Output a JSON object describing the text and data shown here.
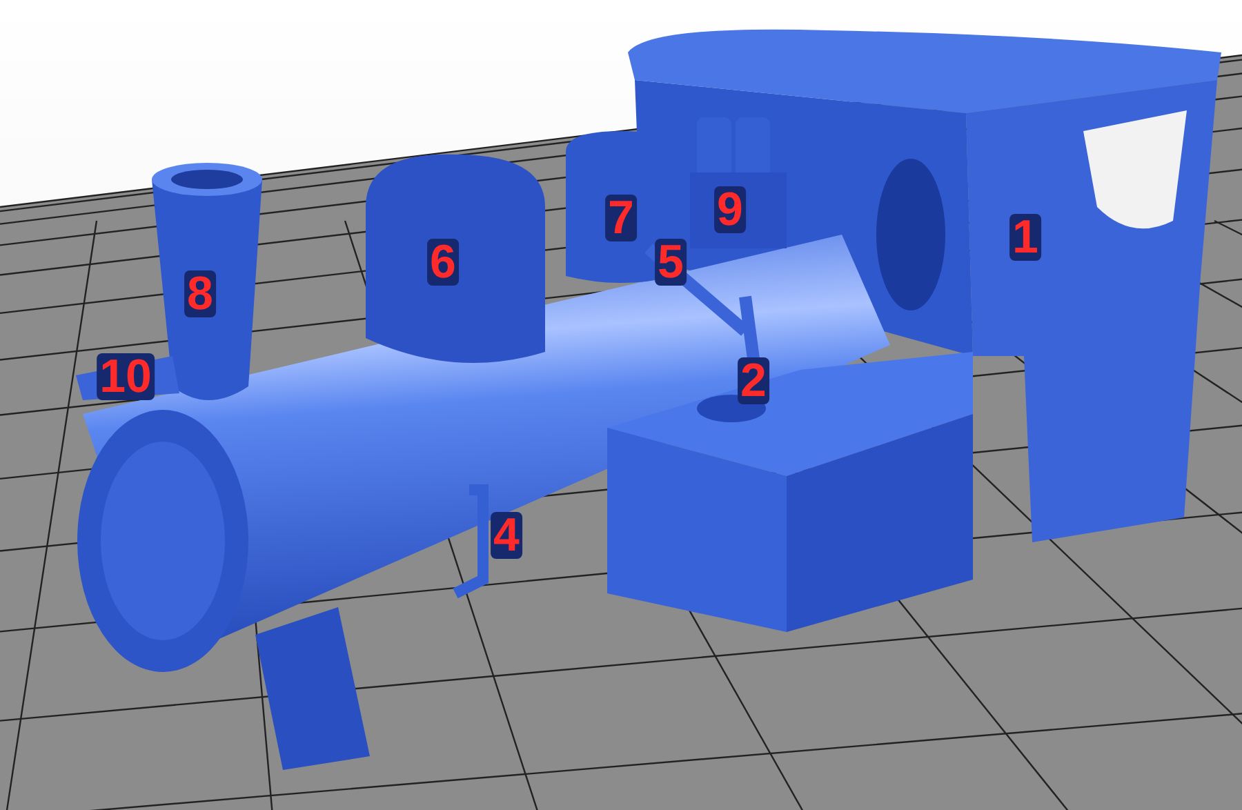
{
  "callouts": [
    {
      "label": "1"
    },
    {
      "label": "2"
    },
    {
      "label": "4"
    },
    {
      "label": "5"
    },
    {
      "label": "6"
    },
    {
      "label": "7"
    },
    {
      "label": "8"
    },
    {
      "label": "9"
    },
    {
      "label": "10"
    }
  ]
}
